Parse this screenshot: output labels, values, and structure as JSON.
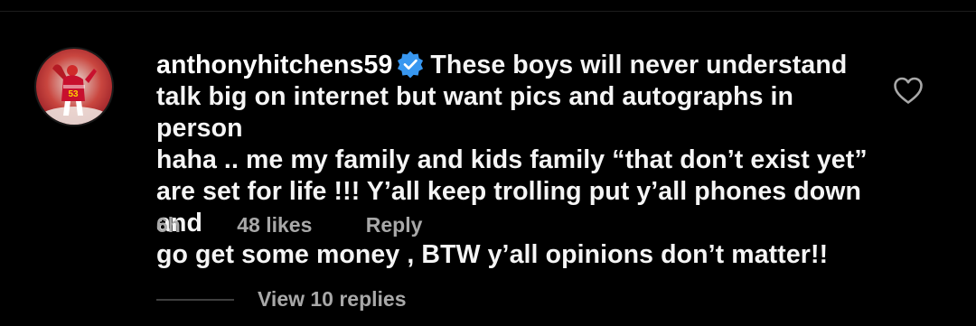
{
  "comment": {
    "username": "anthonyhitchens59",
    "verified": true,
    "lines": [
      "These boys will never understand",
      "talk big on internet but want pics and autographs in person",
      "haha .. me my family and kids family “that don’t exist yet”",
      "are set for life !!! Y’all keep trolling put y’all phones down and",
      "go get some money , BTW y’all opinions don’t matter!!"
    ],
    "time": "6h",
    "likes": "48 likes",
    "reply_label": "Reply",
    "view_replies_label": "View 10 replies",
    "avatar_jersey_number": "53"
  },
  "colors": {
    "background": "#000000",
    "text": "#f5f5f5",
    "meta": "#a8a8a8",
    "verified_blue": "#3897f0",
    "avatar_red": "#c8102e"
  },
  "icons": {
    "verified": "verified-badge-icon",
    "like": "heart-outline-icon"
  }
}
